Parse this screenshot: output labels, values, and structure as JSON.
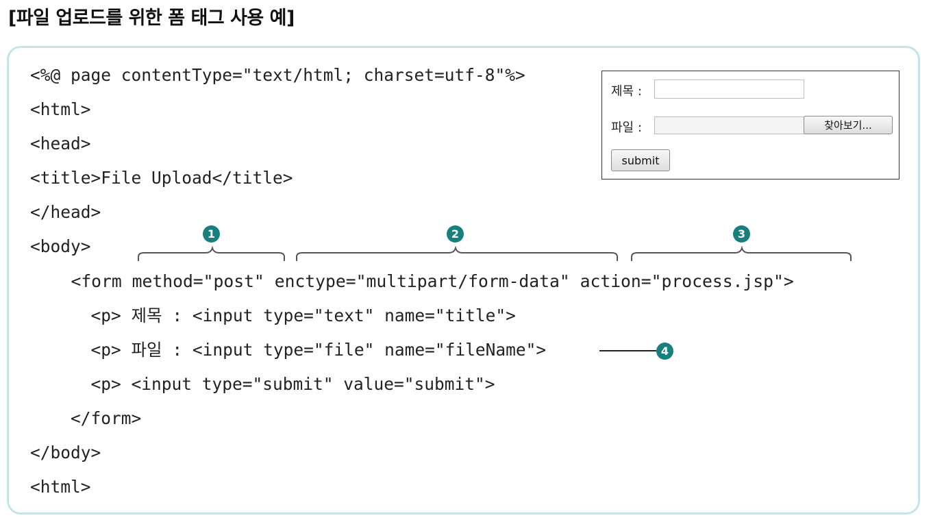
{
  "heading": "[파일 업로드를 위한 폼 태그 사용 예]",
  "code_lines": [
    "<%@ page contentType=\"text/html; charset=utf-8\"%>",
    "<html>",
    "<head>",
    "<title>File Upload</title>",
    "</head>",
    "<body>",
    "    <form method=\"post\" enctype=\"multipart/form-data\" action=\"process.jsp\">",
    "      <p> 제목 : <input type=\"text\" name=\"title\">",
    "      <p> 파일 : <input type=\"file\" name=\"fileName\">",
    "      <p> <input type=\"submit\" value=\"submit\">",
    "    </form>",
    "</body>",
    "<html>"
  ],
  "preview": {
    "title_label": "제목 :",
    "title_value": "",
    "file_label": "파일 :",
    "file_value": "",
    "browse_button": "찾아보기...",
    "submit_button": "submit"
  },
  "callouts": {
    "method": "1",
    "enctype": "2",
    "action": "3",
    "file_input": "4"
  },
  "colors": {
    "frame_border": "#c6e4e4",
    "badge": "#17807e",
    "bracket": "#555555"
  }
}
